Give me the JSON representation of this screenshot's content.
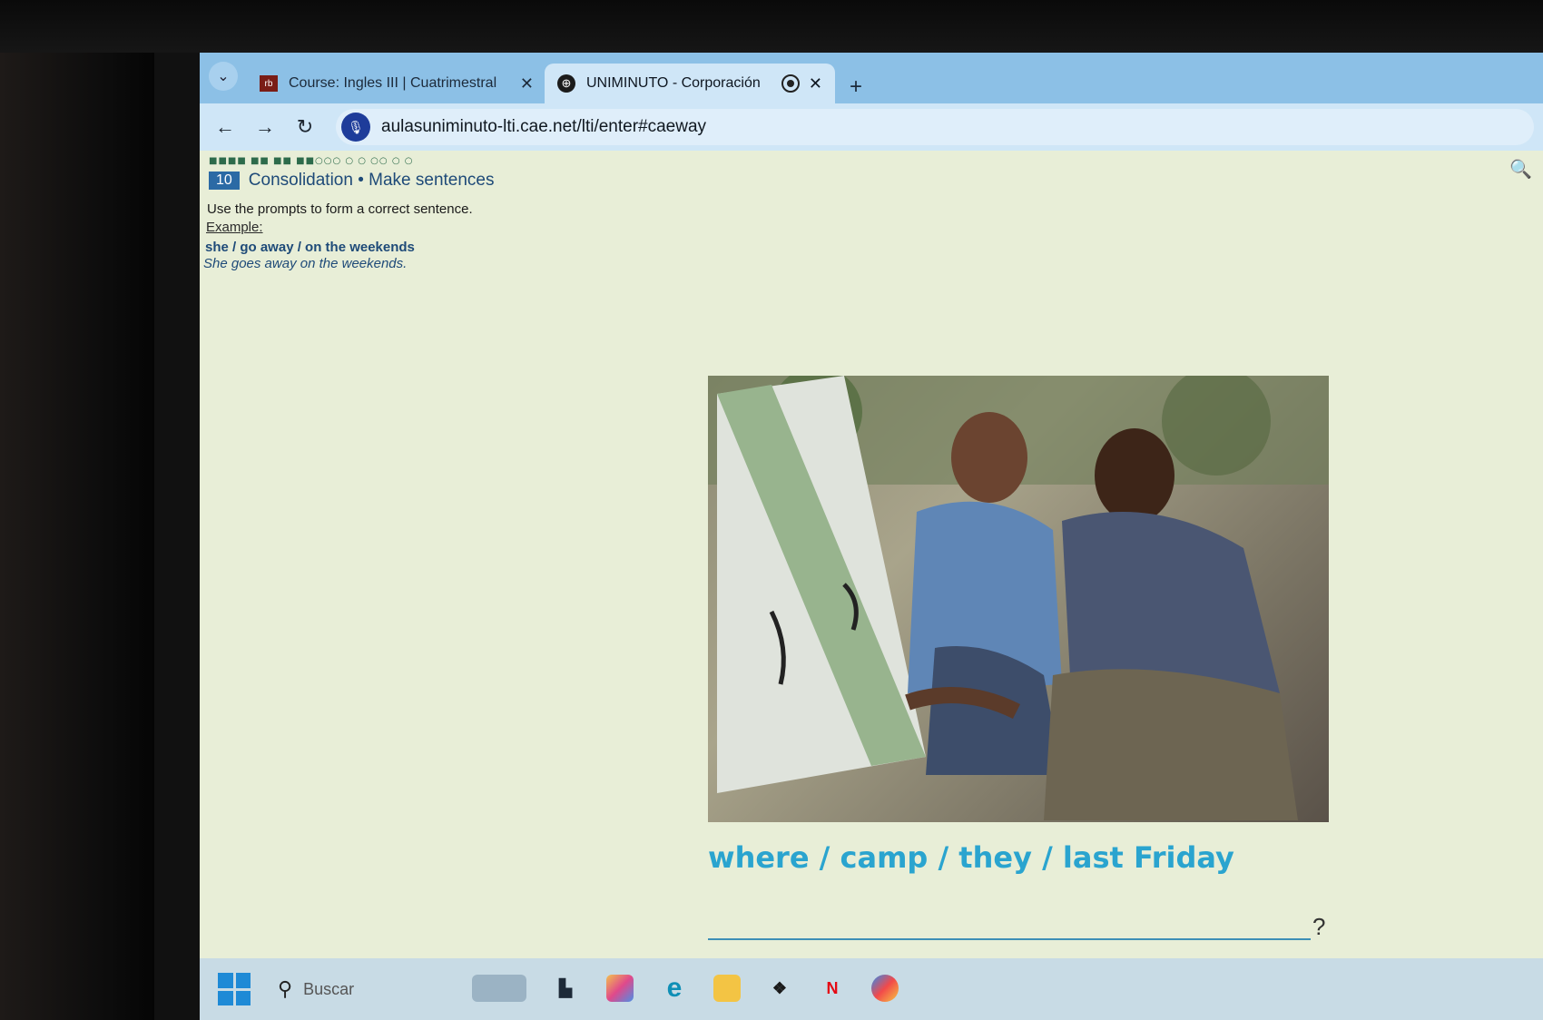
{
  "browser": {
    "tabs": [
      {
        "title": "Course: Ingles III | Cuatrimestral",
        "favicon_text": "rb",
        "active": false
      },
      {
        "title": "UNIMINUTO - Corporación",
        "active": true
      }
    ],
    "address": "aulasuniminuto-lti.cae.net/lti/enter#caeway"
  },
  "exercise": {
    "number": "10",
    "title": "Consolidation • Make sentences",
    "instruction": "Use the prompts to form a correct sentence.",
    "example_label": "Example:",
    "example_prompt": "she / go away / on the weekends",
    "example_answer": "She goes away on the weekends.",
    "prompt": "where / camp / they / last Friday",
    "answer_value": "",
    "answer_suffix": "?"
  },
  "taskbar": {
    "search_placeholder": "Buscar"
  },
  "colors": {
    "prompt": "#2aa4cf",
    "heading": "#1e4a78",
    "page_background": "#e8eed7"
  }
}
